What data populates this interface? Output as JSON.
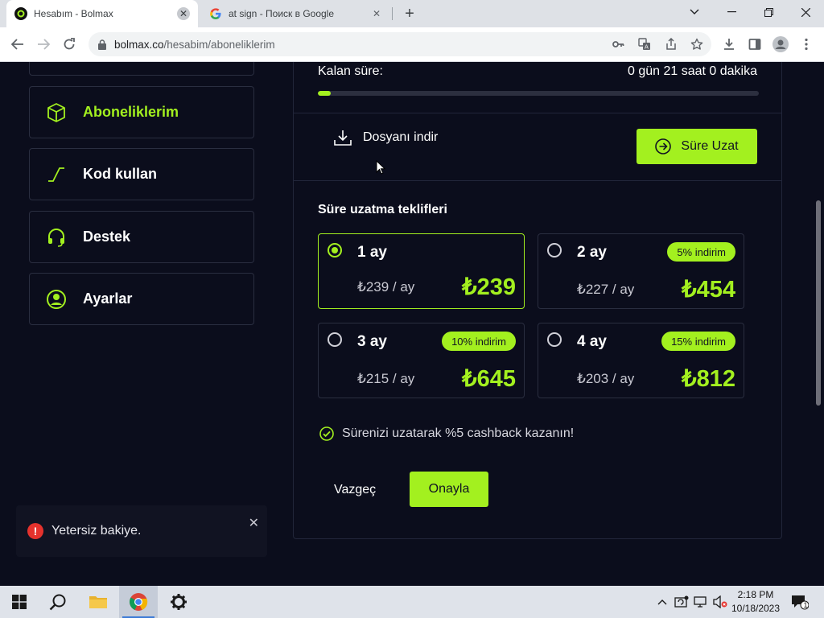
{
  "browser": {
    "tabs": [
      {
        "title": "Hesabım - Bolmax",
        "active": true
      },
      {
        "title": "at sign - Поиск в Google",
        "active": false
      }
    ],
    "url_host": "bolmax.co",
    "url_path": "/hesabim/aboneliklerim"
  },
  "sidebar": {
    "items": [
      {
        "label": "Aboneliklerim",
        "icon": "box-icon",
        "active": true
      },
      {
        "label": "Kod kullan",
        "icon": "code-icon",
        "active": false
      },
      {
        "label": "Destek",
        "icon": "headset-icon",
        "active": false
      },
      {
        "label": "Ayarlar",
        "icon": "user-icon",
        "active": false
      }
    ]
  },
  "subscription": {
    "remaining_label": "Kalan süre:",
    "remaining_value": "0 gün 21 saat 0 dakika",
    "remaining_progress": 0.03,
    "download_label": "Dosyanı indir",
    "extend_label": "Süre Uzat"
  },
  "offers": {
    "title": "Süre uzatma teklifleri",
    "items": [
      {
        "months": "1 ay",
        "per_month": "₺239 / ay",
        "total": "₺239",
        "badge": "",
        "selected": true
      },
      {
        "months": "2 ay",
        "per_month": "₺227 / ay",
        "total": "₺454",
        "badge": "5% indirim",
        "selected": false
      },
      {
        "months": "3 ay",
        "per_month": "₺215 / ay",
        "total": "₺645",
        "badge": "10% indirim",
        "selected": false
      },
      {
        "months": "4 ay",
        "per_month": "₺203 / ay",
        "total": "₺812",
        "badge": "15% indirim",
        "selected": false
      }
    ],
    "cashback_text": "Sürenizi uzatarak %5 cashback kazanın!",
    "cancel_label": "Vazgeç",
    "confirm_label": "Onayla"
  },
  "toast": {
    "message": "Yetersiz bakiye."
  },
  "taskbar": {
    "time": "2:18 PM",
    "date": "10/18/2023",
    "notification_count": "1"
  },
  "colors": {
    "accent": "#a3f01f",
    "page_bg": "#0b0d1c",
    "error": "#e5322d"
  }
}
